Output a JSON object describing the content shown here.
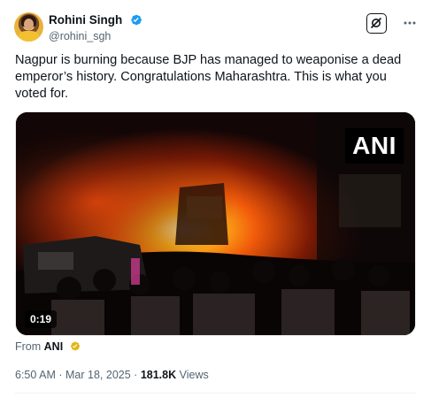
{
  "author": {
    "display_name": "Rohini Singh",
    "handle": "@rohini_sgh",
    "verified_icon": "verified-badge-icon"
  },
  "actions": {
    "grok_icon": "grok-icon",
    "more_icon": "more-icon"
  },
  "tweet": {
    "text": "Nagpur is burning because BJP has managed to weaponise a dead emperor’s history. Congratulations Maharashtra. This is what you voted for."
  },
  "media": {
    "watermark": "ANI",
    "duration": "0:19"
  },
  "source": {
    "prefix": "From",
    "name": "ANI",
    "badge_icon": "gold-verified-badge-icon"
  },
  "meta": {
    "time": "6:50 AM",
    "separator": "·",
    "date": "Mar 18, 2025",
    "views_count": "181.8K",
    "views_label": "Views"
  },
  "colors": {
    "text": "#0f1419",
    "secondary": "#536471",
    "verified_blue": "#1d9bf0",
    "gold": "#e2b719"
  }
}
